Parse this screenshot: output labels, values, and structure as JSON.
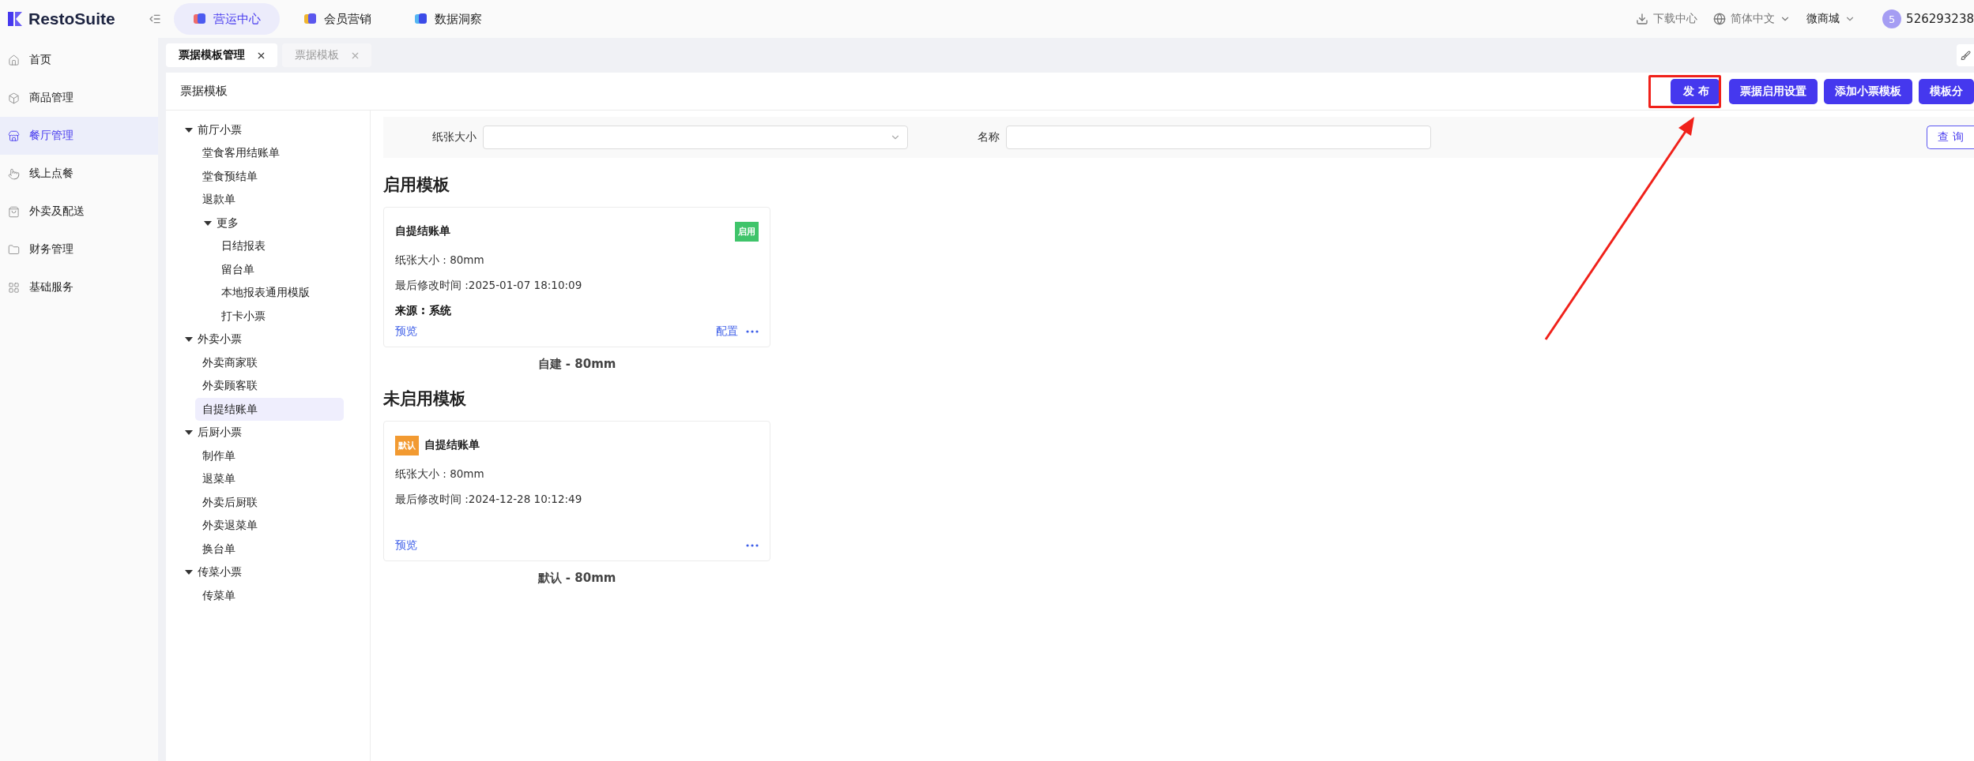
{
  "brand": {
    "name": "RestoSuite"
  },
  "top_nav": [
    {
      "label": "营运中心",
      "selected": true
    },
    {
      "label": "会员营销",
      "selected": false
    },
    {
      "label": "数据洞察",
      "selected": false
    }
  ],
  "header_actions": {
    "download": "下载中心",
    "language": "简体中文",
    "store": "微商城",
    "avatar": "5",
    "user": "526293238"
  },
  "sidebar": [
    {
      "label": "首页",
      "selected": false
    },
    {
      "label": "商品管理",
      "selected": false
    },
    {
      "label": "餐厅管理",
      "selected": true
    },
    {
      "label": "线上点餐",
      "selected": false
    },
    {
      "label": "外卖及配送",
      "selected": false
    },
    {
      "label": "财务管理",
      "selected": false
    },
    {
      "label": "基础服务",
      "selected": false
    }
  ],
  "page_tabs": [
    {
      "label": "票据模板管理",
      "selected": true
    },
    {
      "label": "票据模板",
      "selected": false
    }
  ],
  "panel": {
    "title": "票据模板",
    "buttons": [
      "发 布",
      "票据启用设置",
      "添加小票模板",
      "模板分"
    ]
  },
  "tree": [
    {
      "label": "前厅小票",
      "expanded": true,
      "selected": false,
      "children": [
        {
          "label": "堂食客用结账单",
          "selected": false
        },
        {
          "label": "堂食预结单",
          "selected": false
        },
        {
          "label": "退款单",
          "selected": false
        },
        {
          "label": "更多",
          "expanded": true,
          "selected": false,
          "children": [
            {
              "label": "日结报表",
              "selected": false
            },
            {
              "label": "留台单",
              "selected": false
            },
            {
              "label": "本地报表通用模版",
              "selected": false
            },
            {
              "label": "打卡小票",
              "selected": false
            }
          ]
        }
      ]
    },
    {
      "label": "外卖小票",
      "expanded": true,
      "selected": false,
      "children": [
        {
          "label": "外卖商家联",
          "selected": false
        },
        {
          "label": "外卖顾客联",
          "selected": false
        },
        {
          "label": "自提结账单",
          "selected": true
        }
      ]
    },
    {
      "label": "后厨小票",
      "expanded": true,
      "selected": false,
      "children": [
        {
          "label": "制作单",
          "selected": false
        },
        {
          "label": "退菜单",
          "selected": false
        },
        {
          "label": "外卖后厨联",
          "selected": false
        },
        {
          "label": "外卖退菜单",
          "selected": false
        },
        {
          "label": "换台单",
          "selected": false
        }
      ]
    },
    {
      "label": "传菜小票",
      "expanded": true,
      "selected": false,
      "children": [
        {
          "label": "传菜单",
          "selected": false
        }
      ]
    }
  ],
  "filters": {
    "fields": [
      {
        "label": "纸张大小",
        "kind": "select"
      },
      {
        "label": "名称",
        "kind": "text"
      }
    ],
    "search_button": "查 询"
  },
  "sections": [
    {
      "title": "启用模板",
      "cards": [
        {
          "name": "自提结账单",
          "badge": {
            "text": "启用",
            "kind": "status"
          },
          "paper": "纸张大小 : 80mm",
          "modified": "最后修改时间 :2025-01-07 18:10:09",
          "source": "来源 : 系统",
          "preview": "预览",
          "configure": "配置",
          "caption": "自建 - 80mm"
        }
      ]
    },
    {
      "title": "未启用模板",
      "cards": [
        {
          "name": "自提结账单",
          "badge": {
            "text": "默认",
            "kind": "default"
          },
          "paper": "纸张大小 : 80mm",
          "modified": "最后修改时间 :2024-12-28 10:12:49",
          "preview": "预览",
          "caption": "默认 - 80mm"
        }
      ]
    }
  ]
}
